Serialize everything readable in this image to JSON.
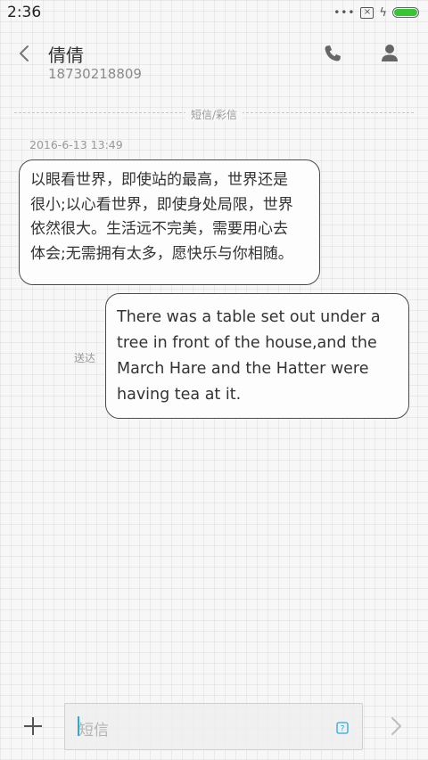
{
  "status_bar": {
    "time": "2:36",
    "icons": [
      "more-dots-icon",
      "no-sim-icon",
      "charging-bolt-icon",
      "battery-icon"
    ],
    "battery_level_percent": 100,
    "battery_color": "#35c535"
  },
  "header": {
    "name": "倩倩",
    "number": "18730218809",
    "icons": [
      "back-arrow-icon",
      "phone-icon",
      "contact-person-icon"
    ]
  },
  "conversation": {
    "type_label": "短信/彩信",
    "timestamp": "2016-6-13 13:49",
    "incoming": {
      "lines": [
        "以眼看世界，即使站的最高，世界还是",
        "很小;以心看世界，即使身处局限，世界",
        "依然很大。生活远不完美，需要用心去",
        "体会;无需拥有太多，愿快乐与你相随。"
      ]
    },
    "outgoing": {
      "status": "送达",
      "lines": [
        "There was a table set out under a",
        "tree in front of the house,and the",
        "March Hare and the Hatter were",
        "having tea at it."
      ]
    }
  },
  "composer": {
    "placeholder": "短信",
    "icons": [
      "plus-icon",
      "template-icon",
      "send-arrow-icon"
    ],
    "accent_color": "#26a9e0"
  }
}
